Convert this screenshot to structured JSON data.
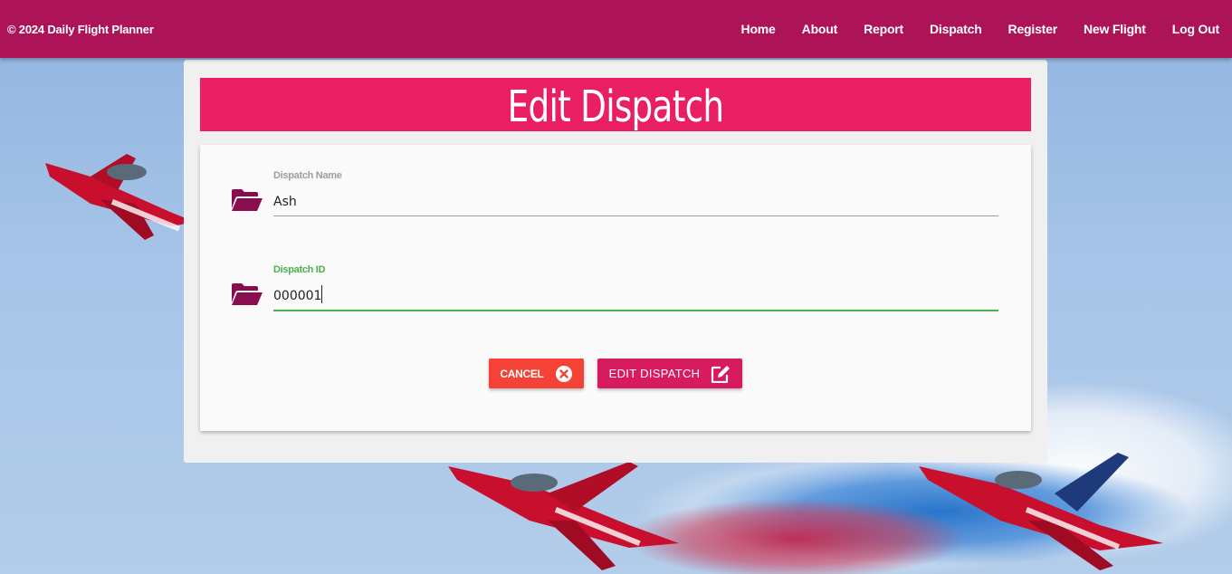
{
  "navbar": {
    "brand": "© 2024 Daily Flight Planner",
    "links": [
      "Home",
      "About",
      "Report",
      "Dispatch",
      "Register",
      "New Flight",
      "Log Out"
    ]
  },
  "page": {
    "title": "Edit Dispatch"
  },
  "form": {
    "fields": [
      {
        "label": "Dispatch Name",
        "value": "Ash",
        "icon": "folder-open-icon"
      },
      {
        "label": "Dispatch ID",
        "value": "000001",
        "icon": "folder-open-icon",
        "focused": true
      }
    ]
  },
  "buttons": {
    "cancel_label": "Cancel",
    "cancel_icon": "close-circle-icon",
    "edit_label": "Edit Dispatch",
    "edit_icon": "edit-icon"
  },
  "colors": {
    "navbar": "#ad1457",
    "title_bar": "#e91e63",
    "folder_icon": "#880e4f",
    "focus": "#4caf50",
    "cancel": "#f44336",
    "edit": "#d81b60"
  }
}
